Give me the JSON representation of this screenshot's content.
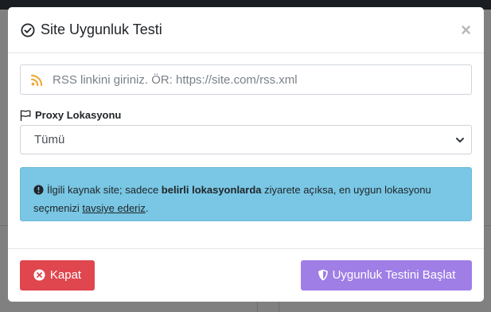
{
  "modal": {
    "title": "Site Uygunluk Testi",
    "close_glyph": "×",
    "title_icon": "check-circle-icon"
  },
  "rss": {
    "icon": "rss-icon",
    "placeholder": "RSS linkini giriniz. ÖR: https://site.com/rss.xml",
    "value": ""
  },
  "proxy": {
    "label": "Proxy Lokasyonu",
    "icon": "flag-icon",
    "selected": "Tümü"
  },
  "info": {
    "icon": "exclamation-circle-icon",
    "text_part1": "İlgili kaynak site; sadece ",
    "text_bold": "belirli lokasyonlarda",
    "text_part2": " ziyarete açıksa, en uygun lokasyonu seçmenizi ",
    "text_link": "tavsiye ederiz",
    "text_end": "."
  },
  "footer": {
    "close_label": "Kapat",
    "start_label": "Uygunluk Testini Başlat"
  },
  "colors": {
    "danger": "#e0464e",
    "purple": "#9f7ee6",
    "info_bg": "#79c7e4",
    "rss_orange": "#f0a631"
  }
}
